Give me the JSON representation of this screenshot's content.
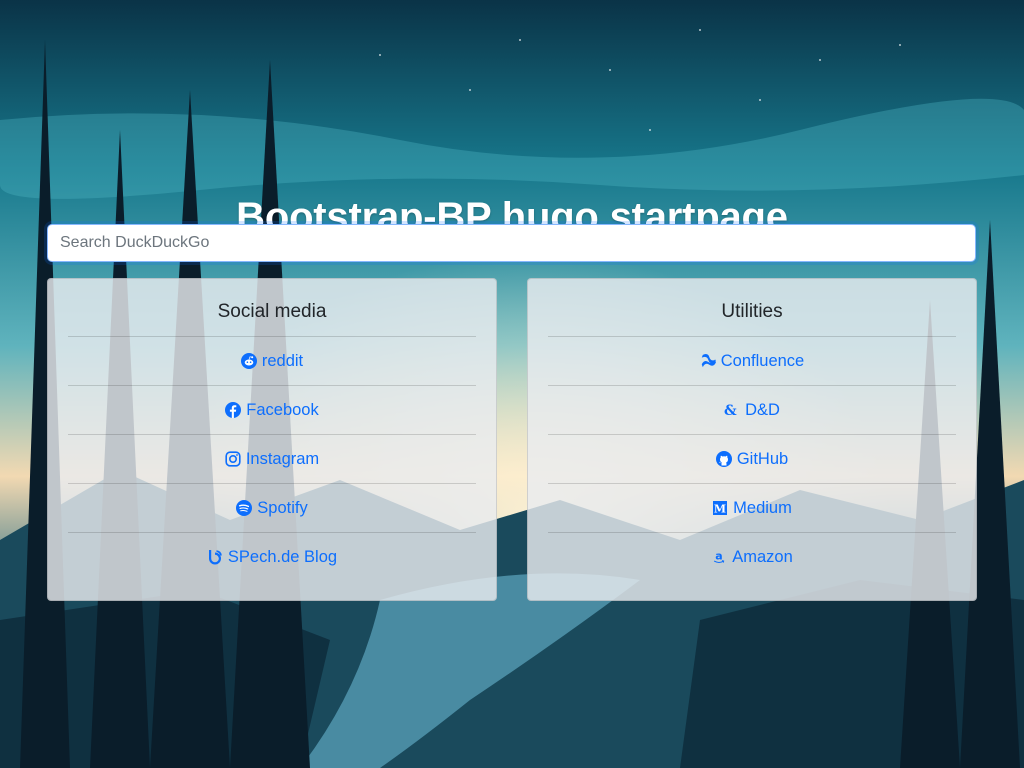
{
  "page": {
    "title": "Bootstrap-BP hugo startpage"
  },
  "search": {
    "placeholder": "Search DuckDuckGo",
    "value": ""
  },
  "cards": [
    {
      "title": "Social media",
      "links": [
        {
          "label": "reddit",
          "icon": "reddit-icon"
        },
        {
          "label": "Facebook",
          "icon": "facebook-icon"
        },
        {
          "label": "Instagram",
          "icon": "instagram-icon"
        },
        {
          "label": "Spotify",
          "icon": "spotify-icon"
        },
        {
          "label": "SPech.de Blog",
          "icon": "blogger-icon"
        }
      ]
    },
    {
      "title": "Utilities",
      "links": [
        {
          "label": "Confluence",
          "icon": "confluence-icon"
        },
        {
          "label": "D&D",
          "icon": "dnd-icon"
        },
        {
          "label": "GitHub",
          "icon": "github-icon"
        },
        {
          "label": "Medium",
          "icon": "medium-icon"
        },
        {
          "label": "Amazon",
          "icon": "amazon-icon"
        }
      ]
    }
  ],
  "colors": {
    "link": "#0d6efd",
    "card_bg": "#e9ecef"
  }
}
